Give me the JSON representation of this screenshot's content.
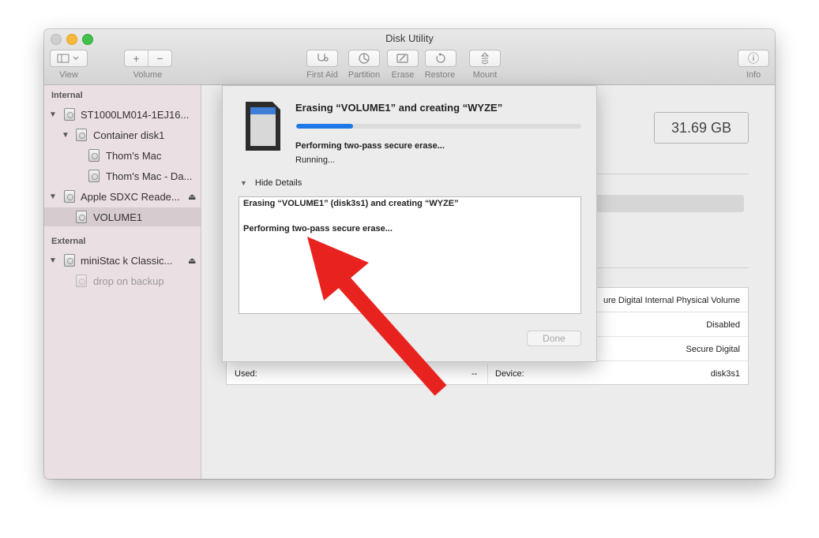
{
  "window": {
    "title": "Disk Utility"
  },
  "toolbar": {
    "view_label": "View",
    "volume_label": "Volume",
    "volume_add": "+",
    "volume_remove": "−",
    "buttons": [
      {
        "label": "First Aid",
        "icon": "stethoscope-icon"
      },
      {
        "label": "Partition",
        "icon": "pie-chart-icon"
      },
      {
        "label": "Erase",
        "icon": "erase-icon"
      },
      {
        "label": "Restore",
        "icon": "restore-icon"
      },
      {
        "label": "Mount",
        "icon": "mount-icon"
      }
    ],
    "info_label": "Info",
    "info_glyph": "ⓘ"
  },
  "sidebar": {
    "internal_header": "Internal",
    "external_header": "External",
    "items": [
      {
        "label": "ST1000LM014-1EJ16..."
      },
      {
        "label": "Container disk1"
      },
      {
        "label": "Thom's Mac"
      },
      {
        "label": "Thom's Mac - Da..."
      },
      {
        "label": "Apple SDXC Reade..."
      },
      {
        "label": "VOLUME1"
      },
      {
        "label": "miniStac k Classic..."
      },
      {
        "label": "drop on backup"
      }
    ],
    "eject_glyph": "⏏"
  },
  "main": {
    "capacity": "31.69 GB",
    "info_rows": [
      {
        "right_value": "ure Digital Internal Physical Volume"
      },
      {
        "right_value": "Disabled"
      },
      {
        "right_value": "Secure Digital"
      },
      {
        "left_label": "Used:",
        "left_value": "--",
        "right_label": "Device:",
        "right_value": "disk3s1"
      }
    ]
  },
  "sheet": {
    "title": "Erasing “VOLUME1” and creating “WYZE”",
    "progress": 0.2,
    "status": "Performing two-pass secure erase...",
    "substatus": "Running...",
    "details_toggle": "Hide Details",
    "log_lines": [
      "Erasing “VOLUME1” (disk3s1) and creating “WYZE”",
      "Performing two-pass secure erase..."
    ],
    "done_label": "Done"
  },
  "annotation": {
    "arrow_color": "#e8231f"
  }
}
